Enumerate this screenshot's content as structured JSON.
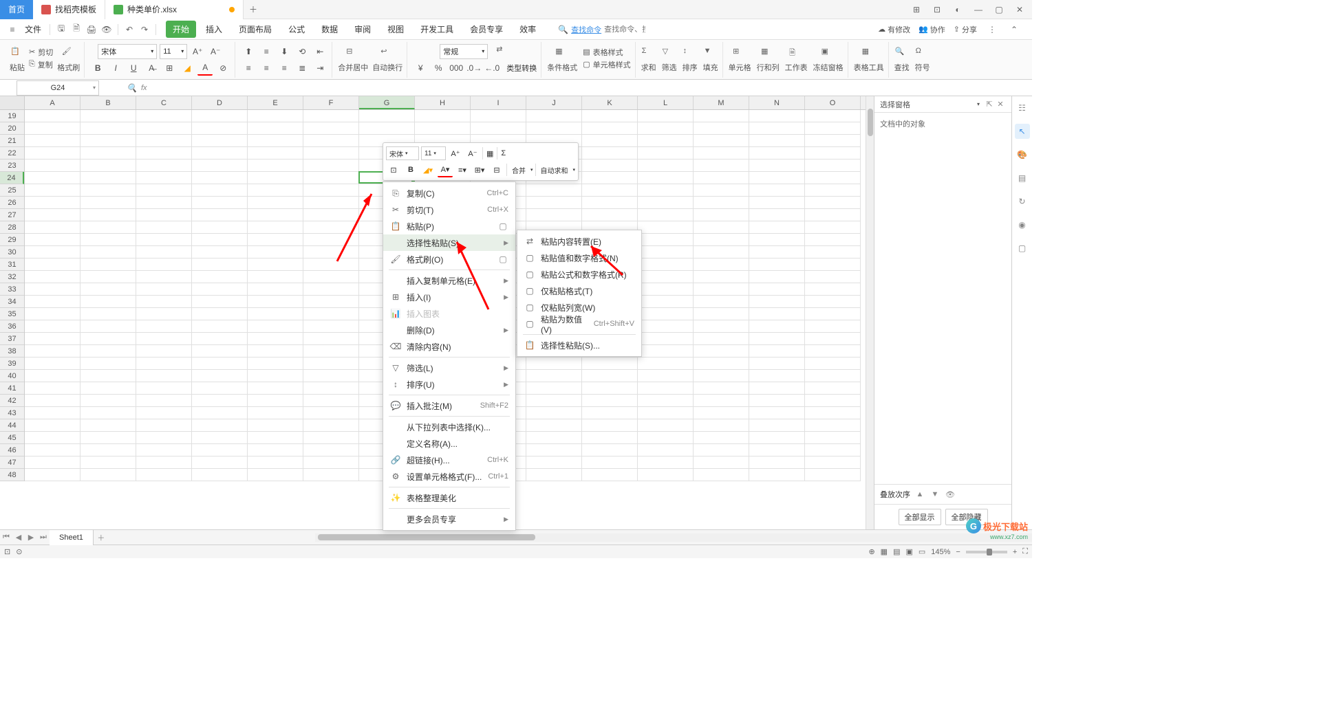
{
  "tabs": {
    "home": "首页",
    "template": "找稻壳模板",
    "file": "种类单价.xlsx"
  },
  "menu": {
    "file": "文件",
    "tabs": [
      "开始",
      "插入",
      "页面布局",
      "公式",
      "数据",
      "审阅",
      "视图",
      "开发工具",
      "会员专享",
      "效率"
    ],
    "active_index": 0,
    "search_placeholder": "查找命令、搜索模板",
    "search_link": "查找命令"
  },
  "top_right": {
    "changes": "有修改",
    "collab": "协作",
    "share": "分享"
  },
  "ribbon": {
    "paste": "粘贴",
    "cut": "剪切",
    "copy": "复制",
    "format_painter": "格式刷",
    "font": "宋体",
    "size": "11",
    "merge_center": "合并居中",
    "wrap": "自动换行",
    "number_format": "常规",
    "type_convert": "类型转换",
    "cond_fmt": "条件格式",
    "table_fmt": "表格样式",
    "cell_fmt": "单元格样式",
    "sum": "求和",
    "filter": "筛选",
    "sort": "排序",
    "fill": "填充",
    "cells": "单元格",
    "rows_cols": "行和列",
    "worksheet": "工作表",
    "freeze": "冻结窗格",
    "table_tool": "表格工具",
    "find": "查找",
    "symbol": "符号"
  },
  "namebox": "G24",
  "columns": [
    "A",
    "B",
    "C",
    "D",
    "E",
    "F",
    "G",
    "H",
    "I",
    "J",
    "K",
    "L",
    "M",
    "N",
    "O"
  ],
  "rows_start": 19,
  "rows_end": 48,
  "selected_col_index": 6,
  "selected_row": 24,
  "mini": {
    "font": "宋体",
    "size": "11",
    "merge": "合并",
    "autosum": "自动求和"
  },
  "ctx": {
    "copy": "复制(C)",
    "cut": "剪切(T)",
    "paste": "粘贴(P)",
    "paste_special": "选择性粘贴(S)",
    "format_painter": "格式刷(O)",
    "insert_cells": "插入复制单元格(E)",
    "insert": "插入(I)",
    "insert_chart": "插入图表",
    "delete": "删除(D)",
    "clear": "清除内容(N)",
    "filter": "筛选(L)",
    "sort": "排序(U)",
    "comment": "插入批注(M)",
    "dropdown": "从下拉列表中选择(K)...",
    "define_name": "定义名称(A)...",
    "hyperlink": "超链接(H)...",
    "format_cells": "设置单元格格式(F)...",
    "beautify": "表格整理美化",
    "more_member": "更多会员专享",
    "sc_copy": "Ctrl+C",
    "sc_cut": "Ctrl+X",
    "sc_comment": "Shift+F2",
    "sc_hyperlink": "Ctrl+K",
    "sc_formatcells": "Ctrl+1"
  },
  "sub": {
    "transpose": "粘贴内容转置(E)",
    "values_num": "粘贴值和数字格式(N)",
    "formulas_num": "粘贴公式和数字格式(R)",
    "formats_only": "仅粘贴格式(T)",
    "col_width": "仅粘贴列宽(W)",
    "as_values": "粘贴为数值(V)",
    "sc_values": "Ctrl+Shift+V",
    "paste_special": "选择性粘贴(S)..."
  },
  "right_pane": {
    "title": "选择窗格",
    "objects_label": "文档中的对象",
    "stack": "叠放次序",
    "show_all": "全部显示",
    "hide_all": "全部隐藏"
  },
  "sheet_tabs": {
    "sheet1": "Sheet1"
  },
  "status": {
    "zoom": "145%"
  },
  "watermark": {
    "brand": "极光下载站",
    "url": "www.xz7.com"
  }
}
